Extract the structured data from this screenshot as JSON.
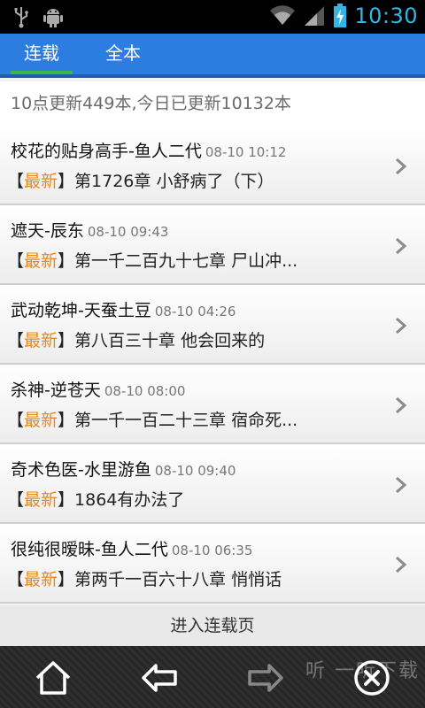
{
  "status": {
    "time": "10:30"
  },
  "tabs": [
    {
      "label": "连载",
      "active": true
    },
    {
      "label": "全本",
      "active": false
    }
  ],
  "summary": "10点更新449本,今日已更新10132本",
  "latest_label": "最新",
  "books": [
    {
      "title": "校花的贴身高手-鱼人二代",
      "time": "08-10 10:12",
      "chapter": "第1726章 小舒病了（下）"
    },
    {
      "title": "遮天-辰东",
      "time": "08-10 09:43",
      "chapter": "第一千二百九十七章 尸山冲..."
    },
    {
      "title": "武动乾坤-天蚕土豆",
      "time": "08-10 04:26",
      "chapter": "第八百三十章 他会回来的"
    },
    {
      "title": "杀神-逆苍天",
      "time": "08-10 08:00",
      "chapter": "第一千一百二十三章 宿命死..."
    },
    {
      "title": "奇术色医-水里游鱼",
      "time": "08-10 09:40",
      "chapter": "1864有办法了"
    },
    {
      "title": "很纯很暧昧-鱼人二代",
      "time": "08-10 06:35",
      "chapter": "第两千一百六十八章 悄悄话"
    }
  ],
  "more_label": "进入连载页",
  "watermark": "听 一听下载",
  "colors": {
    "tab_bg": "#2d7de0",
    "tab_indicator": "#3db54a",
    "latest": "#e88a1a",
    "status_accent": "#33b5e5"
  }
}
